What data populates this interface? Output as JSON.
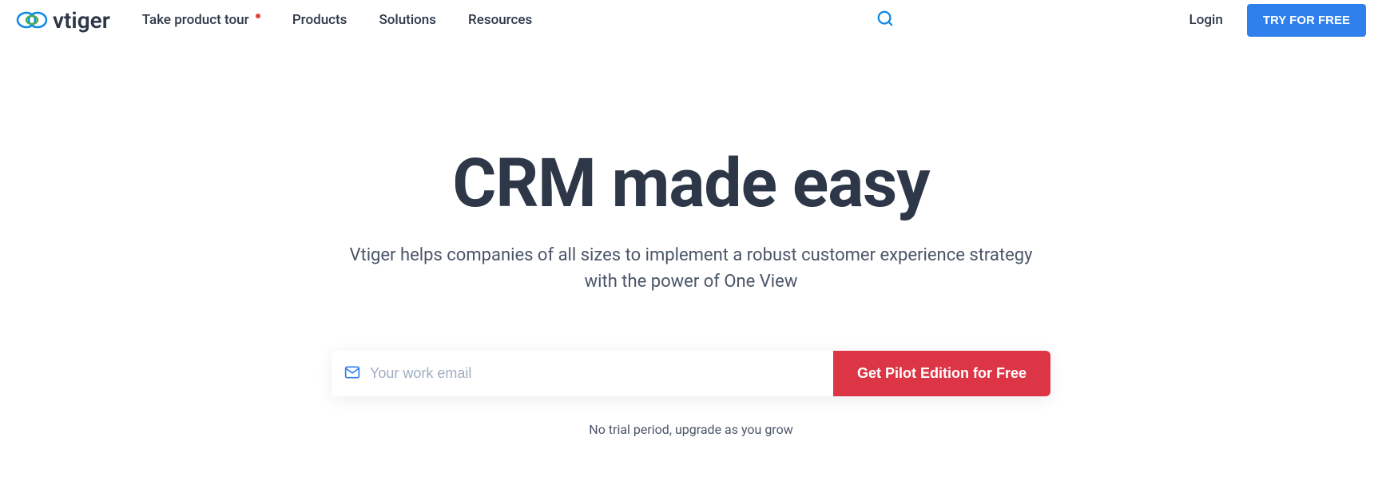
{
  "header": {
    "logo_text": "vtiger",
    "nav": {
      "tour": "Take product tour",
      "products": "Products",
      "solutions": "Solutions",
      "resources": "Resources"
    },
    "login": "Login",
    "try_free": "TRY FOR FREE"
  },
  "hero": {
    "title": "CRM made easy",
    "subtitle": "Vtiger helps companies of all sizes to implement a robust customer experience strategy with the power of One View"
  },
  "form": {
    "email_placeholder": "Your work email",
    "submit_label": "Get Pilot Edition for Free",
    "note": "No trial period, upgrade as you grow"
  }
}
